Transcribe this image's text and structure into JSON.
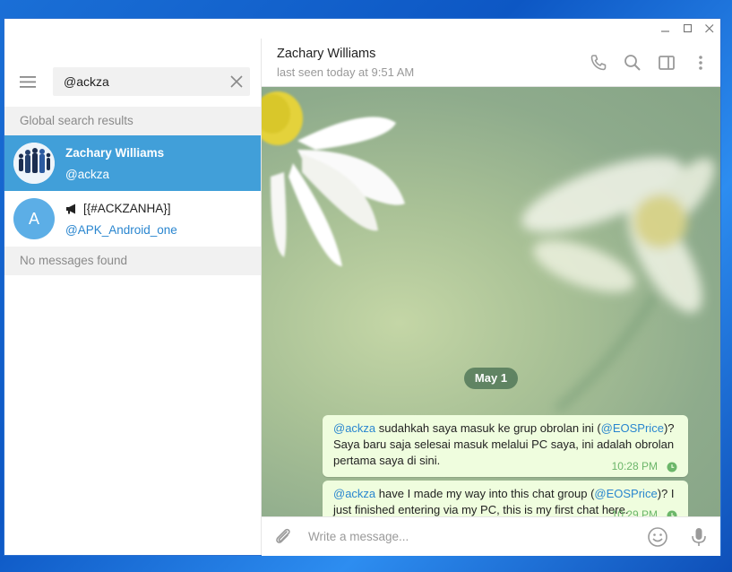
{
  "search": {
    "query": "@ackza"
  },
  "left": {
    "section_global": "Global search results",
    "results": [
      {
        "name": "Zachary Williams",
        "username": "@ackza"
      },
      {
        "avatar_letter": "A",
        "name": "[{#ACKZANHA}]",
        "username": "@APK_Android_one",
        "icon": "megaphone-icon"
      }
    ],
    "section_messages": "No messages found"
  },
  "chat": {
    "peer_name": "Zachary Williams",
    "peer_status": "last seen today at 9:51 AM",
    "date_label": "May 1",
    "messages": [
      {
        "mention": "@ackza",
        "text_a": " sudahkah saya masuk ke grup obrolan ini (",
        "link": "@EOSPrice",
        "text_b": ")? Saya baru saja selesai masuk melalui PC saya, ini adalah obrolan pertama saya di sini.",
        "time": "10:28 PM"
      },
      {
        "mention": "@ackza",
        "text_a": " have I made my way into this chat group (",
        "link": "@EOSPrice",
        "text_b": ")? I just finished entering via my PC, this is my first chat here.",
        "time": "10:29 PM"
      }
    ],
    "composer_placeholder": "Write a message..."
  },
  "colors": {
    "accent": "#419fd9",
    "bubble": "#effdde",
    "link": "#2a86cf",
    "time_green": "#6cb66a"
  }
}
